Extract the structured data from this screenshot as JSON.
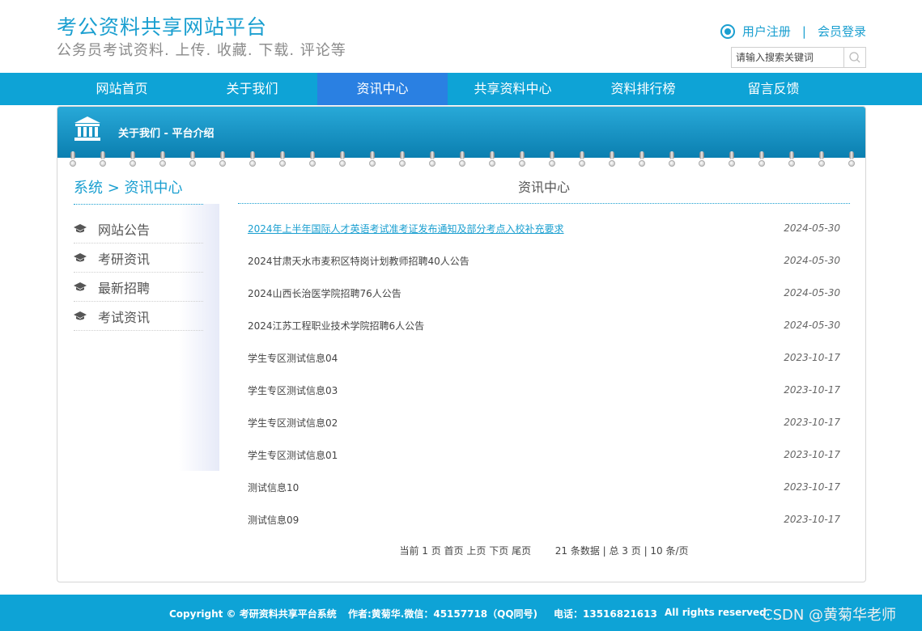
{
  "header": {
    "title": "考公资料共享网站平台",
    "subtitle": "公务员考试资料. 上传. 收藏. 下载. 评论等",
    "register": "用户注册",
    "separator": "|",
    "login": "会员登录",
    "search_placeholder": "请输入搜索关键词"
  },
  "nav": {
    "items": [
      "网站首页",
      "关于我们",
      "资讯中心",
      "共享资料中心",
      "资料排行榜",
      "留言反馈"
    ],
    "active": "资讯中心"
  },
  "banner": {
    "title": "关于我们 - 平台介绍"
  },
  "sidebar": {
    "heading": "系统 > 资讯中心",
    "items": [
      "网站公告",
      "考研资讯",
      "最新招聘",
      "考试资讯"
    ]
  },
  "content": {
    "title": "资讯中心",
    "news": [
      {
        "title": "2024年上半年国际人才英语考试准考证发布通知及部分考点入校补充要求",
        "date": "2024-05-30"
      },
      {
        "title": "2024甘肃天水市麦积区特岗计划教师招聘40人公告",
        "date": "2024-05-30"
      },
      {
        "title": "2024山西长治医学院招聘76人公告",
        "date": "2024-05-30"
      },
      {
        "title": "2024江苏工程职业技术学院招聘6人公告",
        "date": "2024-05-30"
      },
      {
        "title": "学生专区测试信息04",
        "date": "2023-10-17"
      },
      {
        "title": "学生专区测试信息03",
        "date": "2023-10-17"
      },
      {
        "title": "学生专区测试信息02",
        "date": "2023-10-17"
      },
      {
        "title": "学生专区测试信息01",
        "date": "2023-10-17"
      },
      {
        "title": "测试信息10",
        "date": "2023-10-17"
      },
      {
        "title": "测试信息09",
        "date": "2023-10-17"
      }
    ]
  },
  "pager": {
    "current": "当前 1 页",
    "first": "首页",
    "prev": "上页",
    "next": "下页",
    "last": "尾页",
    "summary": "21 条数据 | 总 3 页 | 10 条/页"
  },
  "footer": {
    "copyright": "Copyright © 考研资料共享平台系统",
    "author": "作者:黄菊华.微信：45157718（QQ同号)",
    "phone": "电话：13516821613",
    "rights": "All rights reserved.",
    "watermark": "CSDN @黄菊华老师"
  },
  "colors": {
    "accent": "#0ea3d6",
    "nav_active": "#2a80e2",
    "link": "#1a9fd0"
  }
}
